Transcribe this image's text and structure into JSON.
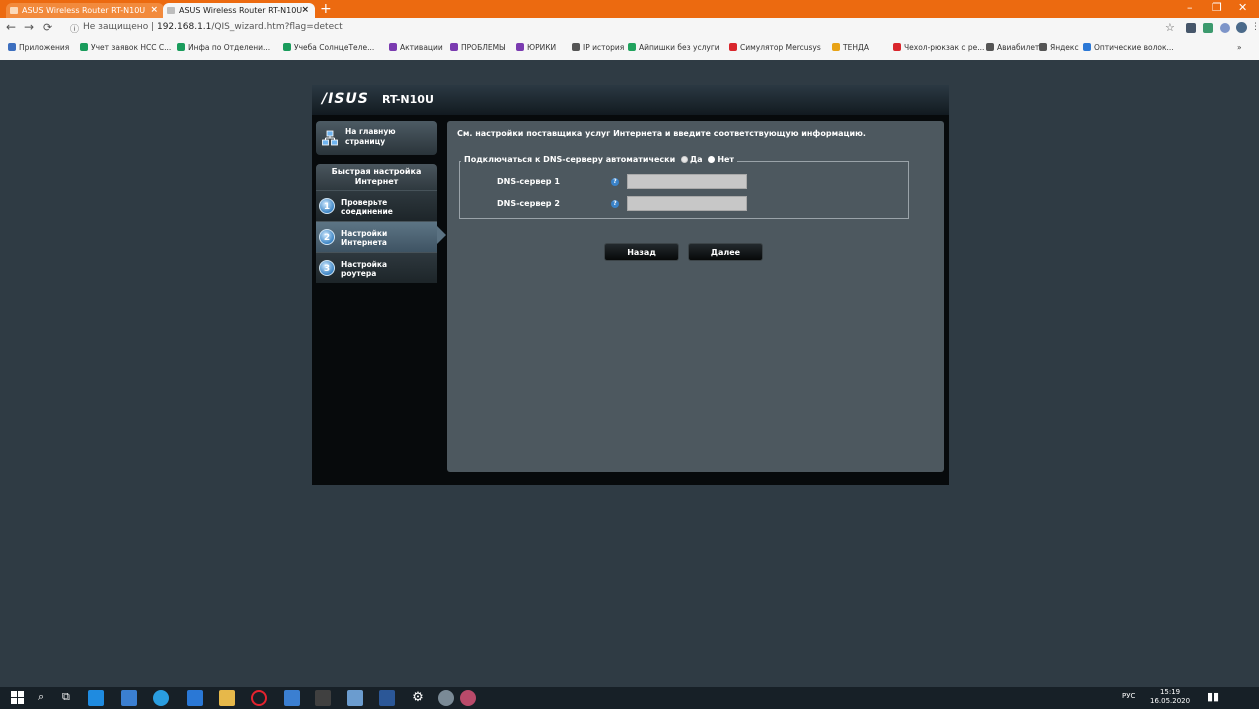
{
  "browser": {
    "tabs": [
      {
        "title": "ASUS Wireless Router RT-N10U",
        "close": "×"
      },
      {
        "title": "ASUS Wireless Router RT-N10U",
        "close": "×"
      }
    ],
    "new_tab": "+",
    "window_controls": {
      "minimize": "–",
      "restore": "❐",
      "close": "✕"
    },
    "url_security": "Не защищено",
    "url_host": "192.168.1.1",
    "url_path": "/QIS_wizard.htm?flag=detect",
    "bookmarks": [
      {
        "label": "Приложения",
        "color": "#3d6fbf"
      },
      {
        "label": "Учет заявок НСС С...",
        "color": "#1a9c5c"
      },
      {
        "label": "Инфа по Отделени...",
        "color": "#1a9c5c"
      },
      {
        "label": "Учеба СолнцеТеле...",
        "color": "#1a9c5c"
      },
      {
        "label": "Активации",
        "color": "#7a3bb0"
      },
      {
        "label": "ПРОБЛЕМЫ",
        "color": "#7a3bb0"
      },
      {
        "label": "ЮРИКИ",
        "color": "#7a3bb0"
      },
      {
        "label": "IP история",
        "color": "#555555"
      },
      {
        "label": "Айпишки без услуги",
        "color": "#21a35e"
      },
      {
        "label": "Симулятор Mercusys",
        "color": "#d9262c"
      },
      {
        "label": "ТЕНДА",
        "color": "#e8a317"
      },
      {
        "label": "Чехол-рюкзак с ре...",
        "color": "#d9262c"
      },
      {
        "label": "Авиабилеты",
        "color": "#555555"
      },
      {
        "label": "Яндекс",
        "color": "#555555"
      },
      {
        "label": "Оптические волок...",
        "color": "#2b78d6"
      }
    ],
    "bookmarks_more": "»"
  },
  "router": {
    "logo": "/ISUS",
    "model": "RT-N10U",
    "home_label": "На главную страницу",
    "qis_title": "Быстрая настройка Интернет",
    "steps": [
      {
        "num": "1",
        "label": "Проверьте соединение"
      },
      {
        "num": "2",
        "label": "Настройки Интернета"
      },
      {
        "num": "3",
        "label": "Настройка роутера"
      }
    ],
    "panel_title": "См. настройки поставщика услуг Интернета и введите соответствующую информацию.",
    "dns_auto_label": "Подключаться к DNS-серверу автоматически",
    "yes": "Да",
    "no": "Нет",
    "dns1_label": "DNS-сервер 1",
    "dns2_label": "DNS-сервер 2",
    "dns1_value": "",
    "dns2_value": "",
    "back_button": "Назад",
    "next_button": "Далее"
  },
  "taskbar": {
    "lang": "РУС",
    "time": "15:19",
    "date": "16.05.2020"
  }
}
